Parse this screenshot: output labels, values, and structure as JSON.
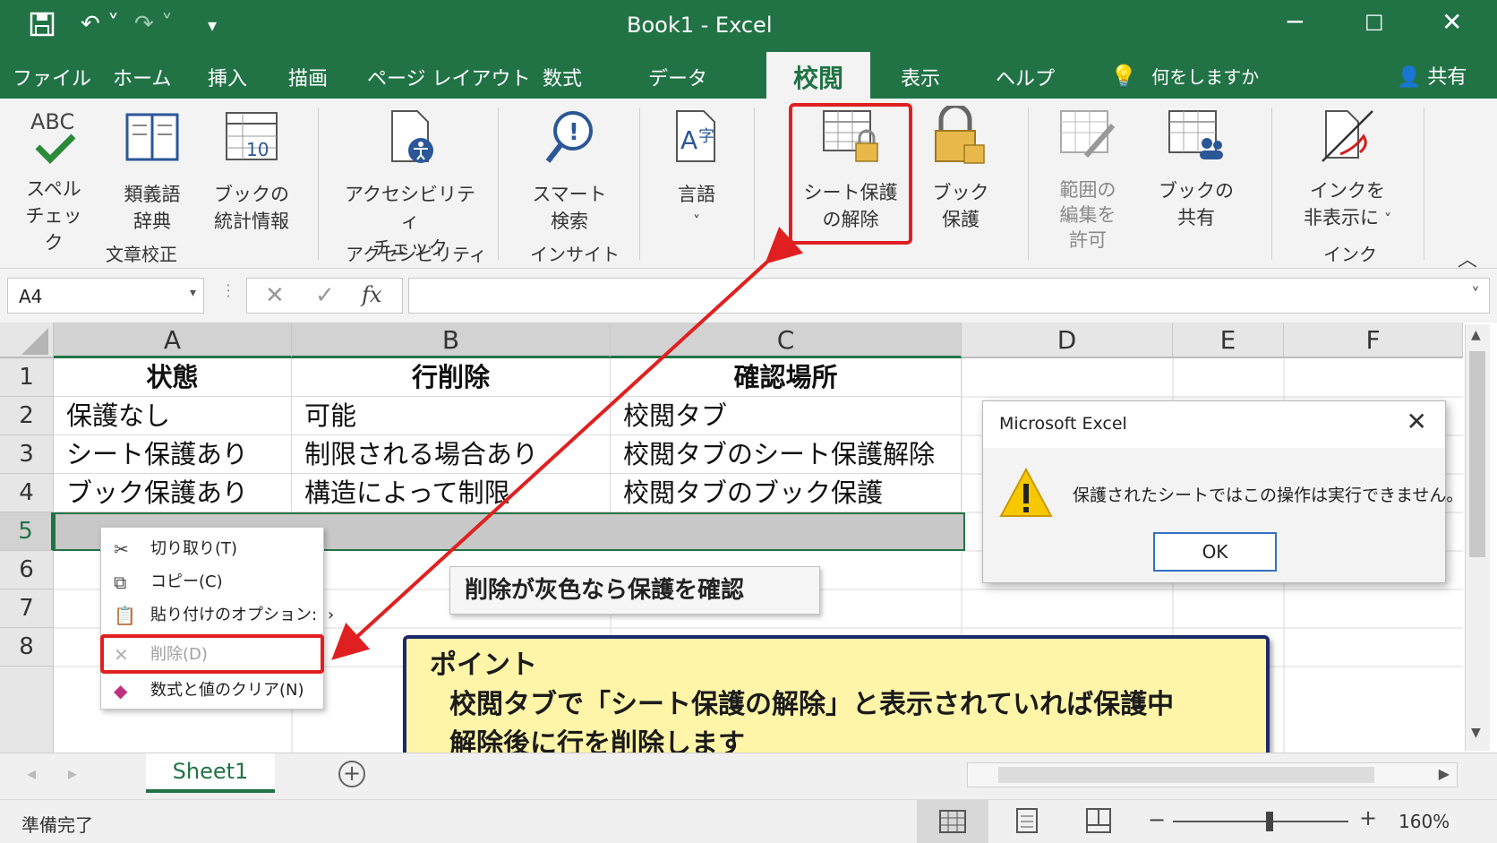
{
  "window": {
    "title": "Book1 - Excel"
  },
  "menu": {
    "tabs": [
      "ファイル",
      "ホーム",
      "挿入",
      "描画",
      "ページ レイアウト",
      "数式",
      "データ",
      "校閲",
      "表示",
      "ヘルプ"
    ],
    "active_tab": "校閲",
    "tell_me": "何をしますか",
    "share": "共有"
  },
  "ribbon": {
    "spell_check": [
      "スペル",
      "チェック"
    ],
    "spell_abc": "ABC",
    "thesaurus": [
      "類義語",
      "辞典"
    ],
    "workbook_stats": [
      "ブックの",
      "統計情報"
    ],
    "accessibility_check": [
      "アクセシビリティ",
      "チェック"
    ],
    "smart_lookup": [
      "スマート",
      "検索"
    ],
    "language": "言語",
    "unprotect_sheet": [
      "シート保護",
      "の解除"
    ],
    "protect_workbook": [
      "ブック",
      "保護"
    ],
    "allow_edit_ranges": [
      "範囲の",
      "編集を",
      "許可"
    ],
    "share_workbook": [
      "ブックの",
      "共有"
    ],
    "hide_ink": [
      "インクを",
      "非表示に"
    ],
    "groups": [
      "文章校正",
      "アクセシビリティ",
      "インサイト",
      "インク"
    ]
  },
  "formula_bar": {
    "name_box": "A4",
    "fx": "fx",
    "value": ""
  },
  "grid": {
    "columns": [
      "A",
      "B",
      "C",
      "D",
      "E",
      "F"
    ],
    "rows": [
      "1",
      "2",
      "3",
      "4",
      "5",
      "6",
      "7",
      "8"
    ],
    "headers": [
      "状態",
      "行削除",
      "確認場所"
    ],
    "data": [
      [
        "保護なし",
        "可能",
        "校閲タブ"
      ],
      [
        "シート保護あり",
        "制限される場合あり",
        "校閲タブのシート保護解除"
      ],
      [
        "ブック保護あり",
        "構造によって制限",
        "校閲タブのブック保護"
      ]
    ]
  },
  "context_menu": {
    "items": [
      {
        "icon": "scissors-icon",
        "label": "切り取り(T)"
      },
      {
        "icon": "copy-icon",
        "label": "コピー(C)"
      },
      {
        "icon": "paste-icon",
        "label": "貼り付けのオプション:"
      },
      {
        "icon": "delete-icon",
        "label": "削除(D)"
      },
      {
        "icon": "eraser-icon",
        "label": "数式と値のクリア(N)"
      }
    ]
  },
  "dialog": {
    "title": "Microsoft Excel",
    "message": "保護されたシートではこの操作は実行できません。",
    "ok": "OK"
  },
  "callouts": {
    "gray_check": "削除が灰色なら保護を確認",
    "point_title": "ポイント",
    "point_line1": "校閲タブで「シート保護の解除」と表示されていれば保護中",
    "point_line2": "解除後に行を削除します"
  },
  "sheet_tabs": [
    "Sheet1"
  ],
  "status": {
    "ready": "準備完了",
    "zoom": "160%"
  },
  "colors": {
    "excel_green": "#217346",
    "highlight_red": "#e02020",
    "callout_yellow": "#fff5a8"
  }
}
